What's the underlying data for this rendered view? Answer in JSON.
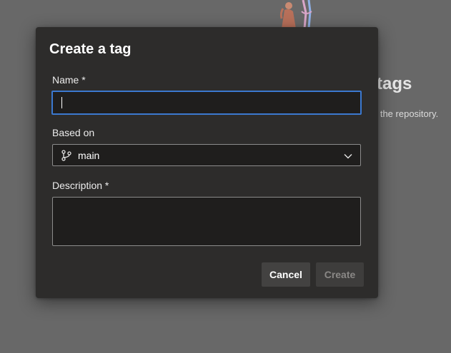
{
  "background": {
    "heading": "tags",
    "subtext": "o the repository.",
    "illustration_icon": "people-illustration"
  },
  "dialog": {
    "title": "Create a tag",
    "name": {
      "label": "Name *",
      "value": ""
    },
    "based_on": {
      "label": "Based on",
      "value": "main",
      "icon": "branch-icon"
    },
    "description": {
      "label": "Description *",
      "value": ""
    },
    "buttons": {
      "cancel": "Cancel",
      "create": "Create"
    }
  },
  "colors": {
    "dialog_bg": "#2d2c2b",
    "input_bg": "#1f1e1d",
    "focus_border": "#3b79d0",
    "disabled_text": "#8a8886"
  }
}
